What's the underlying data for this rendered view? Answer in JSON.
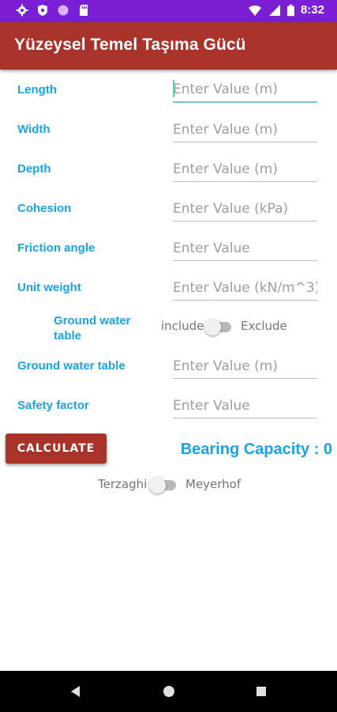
{
  "status_bar": {
    "time": "8:32",
    "left_icons": [
      "settings-icon",
      "shield-icon",
      "circle-icon",
      "sd-card-icon"
    ],
    "right_icons": [
      "wifi-icon",
      "signal-icon",
      "battery-icon"
    ],
    "color": "#7a1fd6"
  },
  "app_bar": {
    "title": "Yüzeysel Temel Taşıma Gücü",
    "color": "#a8332b"
  },
  "form": {
    "fields": [
      {
        "label": "Length",
        "placeholder": "Enter Value (m)",
        "focused": true
      },
      {
        "label": "Width",
        "placeholder": "Enter Value (m)"
      },
      {
        "label": "Depth",
        "placeholder": "Enter Value (m)"
      },
      {
        "label": "Cohesion",
        "placeholder": "Enter Value (kPa)"
      },
      {
        "label": "Friction angle",
        "placeholder": "Enter Value"
      },
      {
        "label": "Unit weight",
        "placeholder": "Enter Value (kN/m^3)"
      }
    ],
    "ground_water_toggle": {
      "label": "Ground water table",
      "left_option": "include",
      "right_option": "Exclude",
      "checked": false
    },
    "fields_after": [
      {
        "label": "Ground water table",
        "placeholder": "Enter Value (m)"
      },
      {
        "label": "Safety factor",
        "placeholder": "Enter Value"
      }
    ],
    "label_color": "#1aa3e8"
  },
  "actions": {
    "calculate_label": "CALCULATE",
    "result": "Bearing Capacity : 0"
  },
  "method_toggle": {
    "left_option": "Terzaghi",
    "right_option": "Meyerhof",
    "checked": false
  },
  "nav_bar": {
    "icons": [
      "back-icon",
      "home-icon",
      "recents-icon"
    ]
  }
}
